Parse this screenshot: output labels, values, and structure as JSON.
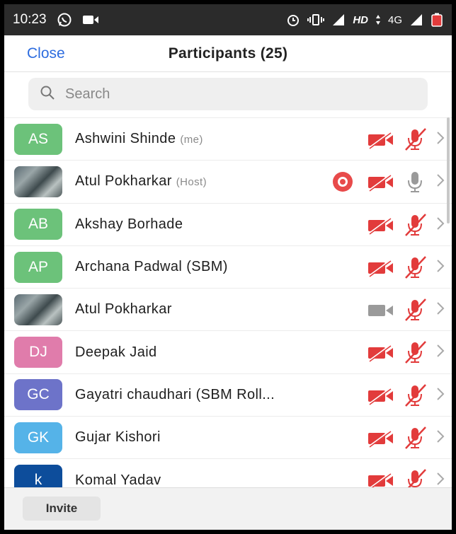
{
  "status_bar": {
    "time": "10:23",
    "network_label": "HD",
    "network_type": "4G",
    "icons": [
      "whatsapp-icon",
      "video-notification-icon",
      "alarm-icon",
      "vibrate-icon",
      "signal-icon",
      "data-transfer-icon",
      "signal-icon",
      "battery-icon"
    ]
  },
  "header": {
    "close_label": "Close",
    "title": "Participants (25)"
  },
  "search": {
    "placeholder": "Search"
  },
  "participants": [
    {
      "initials": "AS",
      "name": "Ashwini Shinde",
      "tag": "(me)",
      "avatar_color": "#6cc27a",
      "photo": false,
      "video": "off",
      "mic": "muted",
      "recording": false
    },
    {
      "initials": "",
      "name": "Atul Pokharkar",
      "tag": "(Host)",
      "avatar_color": "",
      "photo": true,
      "video": "off",
      "mic": "on",
      "recording": true
    },
    {
      "initials": "AB",
      "name": "Akshay Borhade",
      "tag": "",
      "avatar_color": "#6cc27a",
      "photo": false,
      "video": "off",
      "mic": "muted",
      "recording": false
    },
    {
      "initials": "AP",
      "name": "Archana Padwal (SBM)",
      "tag": "",
      "avatar_color": "#6cc27a",
      "photo": false,
      "video": "off",
      "mic": "muted",
      "recording": false
    },
    {
      "initials": "",
      "name": "Atul Pokharkar",
      "tag": "",
      "avatar_color": "",
      "photo": true,
      "video": "on",
      "mic": "muted",
      "recording": false
    },
    {
      "initials": "DJ",
      "name": "Deepak Jaid",
      "tag": "",
      "avatar_color": "#e07cab",
      "photo": false,
      "video": "off",
      "mic": "muted",
      "recording": false
    },
    {
      "initials": "GC",
      "name": "Gayatri chaudhari (SBM Roll...",
      "tag": "",
      "avatar_color": "#6d73c9",
      "photo": false,
      "video": "off",
      "mic": "muted",
      "recording": false
    },
    {
      "initials": "GK",
      "name": "Gujar Kishori",
      "tag": "",
      "avatar_color": "#55b3e8",
      "photo": false,
      "video": "off",
      "mic": "muted",
      "recording": false
    },
    {
      "initials": "k",
      "name": "Komal Yadav",
      "tag": "",
      "avatar_color": "#0d4d9b",
      "photo": false,
      "video": "off",
      "mic": "muted",
      "recording": false
    }
  ],
  "footer": {
    "invite_label": "Invite"
  },
  "colors": {
    "accent": "#2d6cdf",
    "muted_red": "#e23b3b",
    "icon_gray": "#9a9a9a"
  }
}
